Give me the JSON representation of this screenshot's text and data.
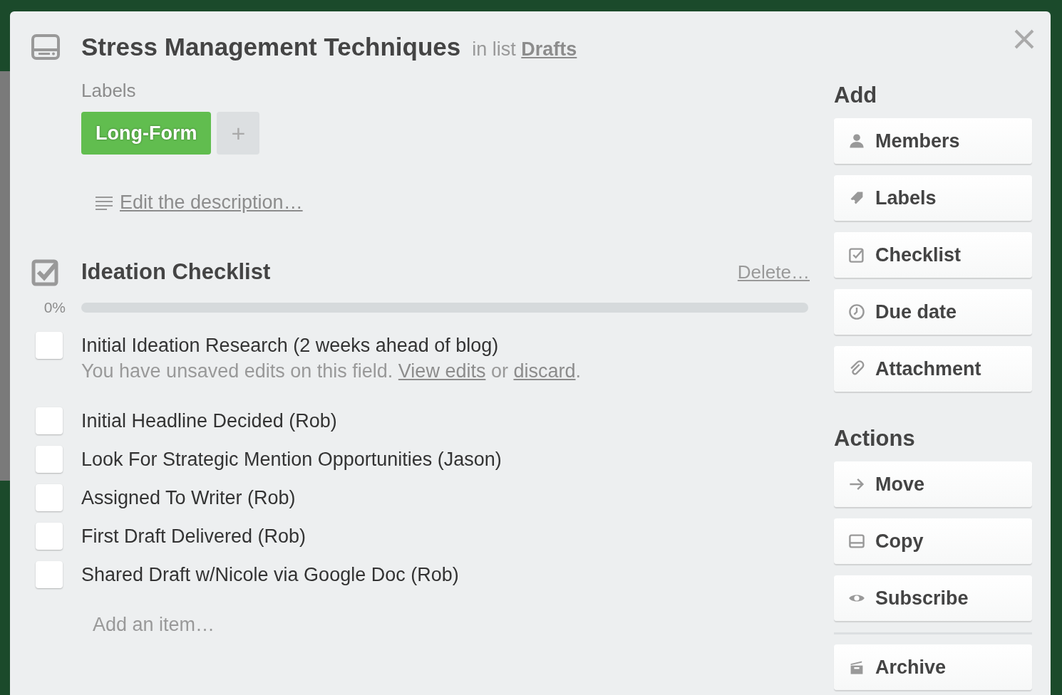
{
  "card": {
    "title": "Stress Management Techniques",
    "list_prefix": "in list",
    "list_name": "Drafts"
  },
  "labels": {
    "heading": "Labels",
    "items": [
      {
        "text": "Long-Form",
        "color": "#61bd4f"
      }
    ],
    "add": "+"
  },
  "description": {
    "link": "Edit the description…"
  },
  "checklist": {
    "title": "Ideation Checklist",
    "delete": "Delete…",
    "percent": "0%",
    "level": 0,
    "items": [
      {
        "text": "Initial Ideation Research (2 weeks ahead of blog)",
        "checked": false,
        "note": {
          "before": "You have unsaved edits on this field.",
          "view": "View edits",
          "middle": "or",
          "discard": "discard",
          "end": "."
        }
      },
      {
        "text": "Initial Headline Decided (Rob)",
        "checked": false
      },
      {
        "text": "Look For Strategic Mention Opportunities (Jason)",
        "checked": false
      },
      {
        "text": "Assigned To Writer (Rob)",
        "checked": false
      },
      {
        "text": "First Draft Delivered (Rob)",
        "checked": false
      },
      {
        "text": "Shared Draft w/Nicole via Google Doc (Rob)",
        "checked": false
      }
    ],
    "add_placeholder": "Add an item…"
  },
  "sidebar": [
    {
      "heading": "Add",
      "buttons": [
        {
          "label": "Members",
          "kind": "person"
        },
        {
          "label": "Labels",
          "kind": "tag"
        },
        {
          "label": "Checklist",
          "kind": "check"
        },
        {
          "label": "Due date",
          "kind": "clock"
        },
        {
          "label": "Attachment",
          "kind": "clip"
        }
      ]
    },
    {
      "heading": "Actions",
      "buttons": [
        {
          "label": "Move",
          "kind": "arrow"
        },
        {
          "label": "Copy",
          "kind": "card"
        },
        {
          "label": "Subscribe",
          "kind": "eye"
        },
        {
          "label": "Archive",
          "kind": "archive",
          "separated": true
        }
      ]
    }
  ]
}
